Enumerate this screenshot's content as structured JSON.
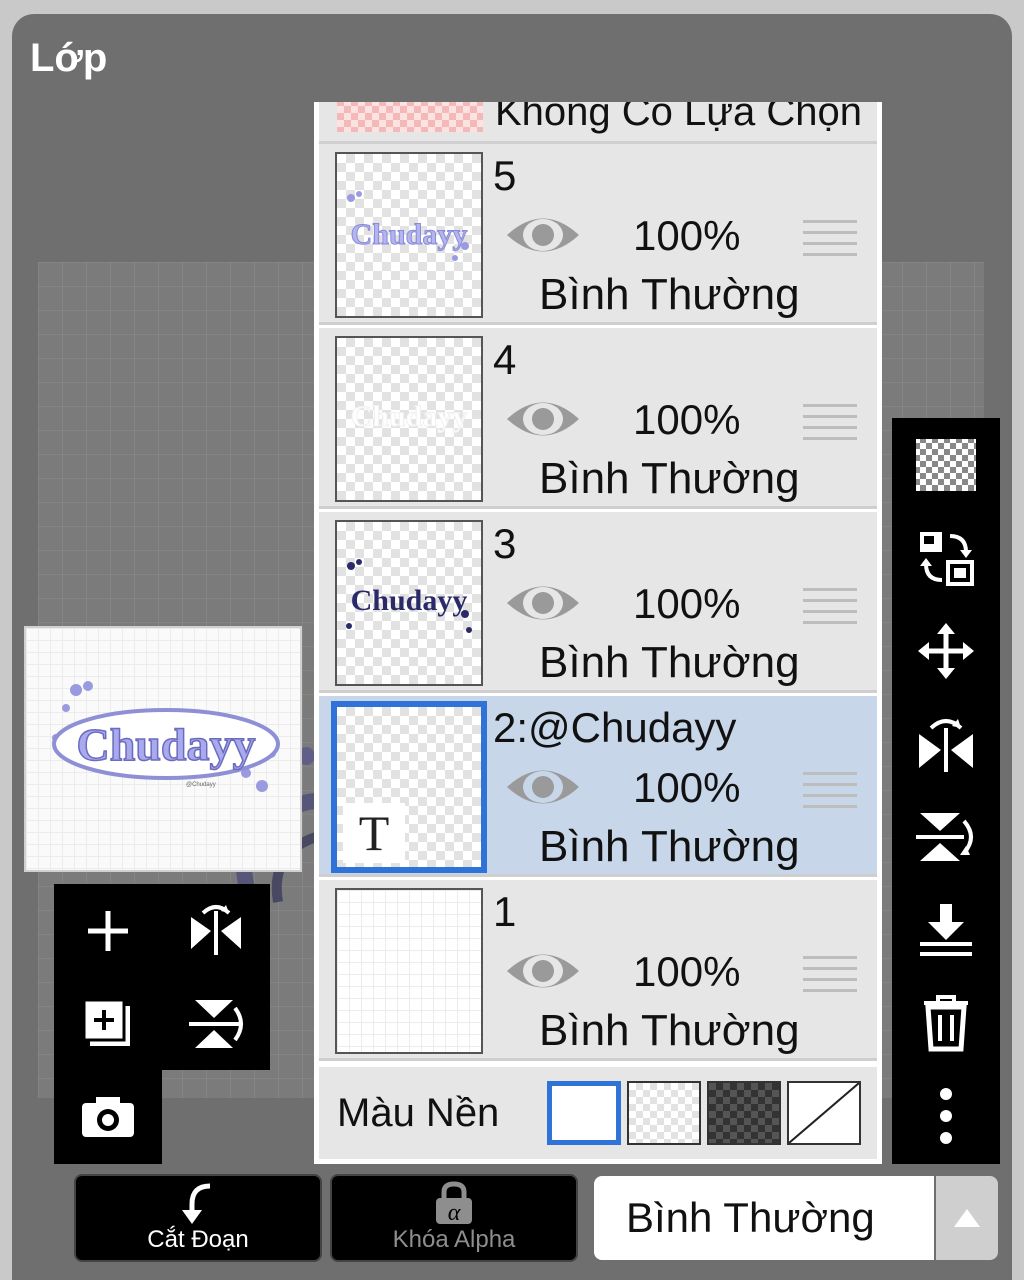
{
  "panel": {
    "title": "Lớp"
  },
  "layers": {
    "top_partial_label": "Không Có Lựa Chọn",
    "items": [
      {
        "name": "5",
        "opacity": "100%",
        "blend": "Bình Thường",
        "thumb_art": "Chudayy",
        "selected": false
      },
      {
        "name": "4",
        "opacity": "100%",
        "blend": "Bình Thường",
        "thumb_art": "Chudayy",
        "selected": false
      },
      {
        "name": "3",
        "opacity": "100%",
        "blend": "Bình Thường",
        "thumb_art": "Chudayy",
        "selected": false
      },
      {
        "name": "2:@Chudayy",
        "opacity": "100%",
        "blend": "Bình Thường",
        "thumb_art": "T",
        "selected": true
      },
      {
        "name": "1",
        "opacity": "100%",
        "blend": "Bình Thường",
        "thumb_art": "",
        "selected": false
      }
    ]
  },
  "background_color": {
    "label": "Màu Nền",
    "options": [
      "white",
      "transparent-light",
      "transparent-dark",
      "none"
    ],
    "selected": "white"
  },
  "bottom_bar": {
    "cut_label": "Cắt Đoạn",
    "alpha_lock_label": "Khóa Alpha",
    "alpha_lock_glyph": "α",
    "blend_mode": "Bình Thường"
  },
  "left_tools": [
    "add-layer-icon",
    "flip-horizontal-icon",
    "add-copy-layer-icon",
    "flip-vertical-icon",
    "camera-icon"
  ],
  "right_tools": [
    "transparency-icon",
    "swap-layer-icon",
    "move-icon",
    "flip-horizontal-icon",
    "flip-vertical-icon",
    "merge-down-icon",
    "trash-icon",
    "more-vertical-icon"
  ],
  "colors": {
    "panel_bg": "#6f6f6f",
    "selected_layer": "#c8d6ea",
    "selected_border": "#2f72d8",
    "art_purple": "#8f8fd6"
  }
}
